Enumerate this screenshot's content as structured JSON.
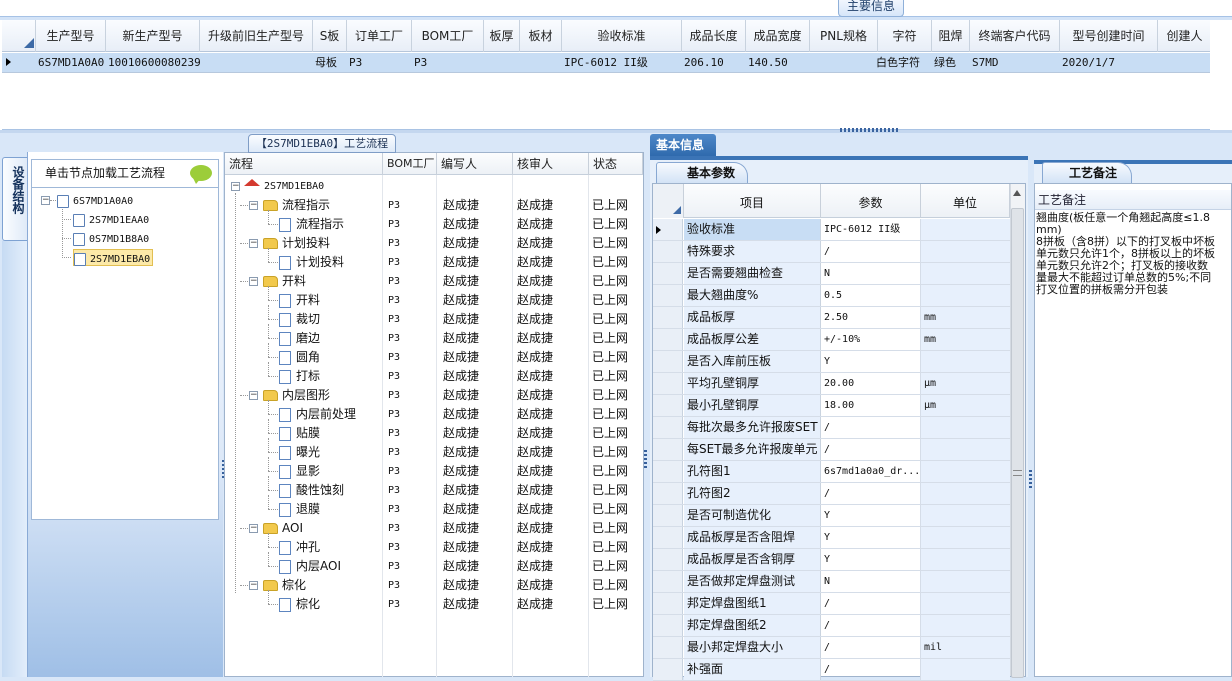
{
  "top": {
    "title": "主要信息",
    "headers": [
      "生产型号",
      "新生产型号",
      "升级前旧生产型号",
      "S板",
      "订单工厂",
      "BOM工厂",
      "板厚",
      "板材",
      "验收标准",
      "成品长度",
      "成品宽度",
      "PNL规格",
      "字符",
      "阻焊",
      "终端客户代码",
      "型号创建时间",
      "创建人"
    ],
    "row": [
      "6S7MD1A0A0",
      "10010600080239",
      "",
      "母板",
      "P3",
      "P3",
      "",
      "",
      "IPC-6012 II级",
      "206.10",
      "140.50",
      "",
      "白色字符",
      "绿色",
      "S7MD",
      "2020/1/7",
      ""
    ]
  },
  "left": {
    "vertical_tab": "设备结构",
    "hint": "单击节点加载工艺流程",
    "tree": {
      "root": "6S7MD1A0A0",
      "children": [
        "2S7MD1EAA0",
        "0S7MD1B8A0",
        "2S7MD1EBA0"
      ]
    }
  },
  "middle": {
    "title": "【2S7MD1EBA0】工艺流程",
    "headers": [
      "流程",
      "BOM工厂",
      "编写人",
      "核审人",
      "状态"
    ],
    "root": "2S7MD1EBA0",
    "rows": [
      {
        "name": "流程指示",
        "level": 1,
        "type": "folder",
        "factory": "P3",
        "writer": "赵成捷",
        "reviewer": "赵成捷",
        "status": "已上网"
      },
      {
        "name": "流程指示",
        "level": 2,
        "type": "doc",
        "factory": "P3",
        "writer": "赵成捷",
        "reviewer": "赵成捷",
        "status": "已上网"
      },
      {
        "name": "计划投料",
        "level": 1,
        "type": "folder",
        "factory": "P3",
        "writer": "赵成捷",
        "reviewer": "赵成捷",
        "status": "已上网"
      },
      {
        "name": "计划投料",
        "level": 2,
        "type": "doc",
        "factory": "P3",
        "writer": "赵成捷",
        "reviewer": "赵成捷",
        "status": "已上网"
      },
      {
        "name": "开料",
        "level": 1,
        "type": "folder",
        "factory": "P3",
        "writer": "赵成捷",
        "reviewer": "赵成捷",
        "status": "已上网"
      },
      {
        "name": "开料",
        "level": 2,
        "type": "doc",
        "factory": "P3",
        "writer": "赵成捷",
        "reviewer": "赵成捷",
        "status": "已上网"
      },
      {
        "name": "裁切",
        "level": 2,
        "type": "doc",
        "factory": "P3",
        "writer": "赵成捷",
        "reviewer": "赵成捷",
        "status": "已上网"
      },
      {
        "name": "磨边",
        "level": 2,
        "type": "doc",
        "factory": "P3",
        "writer": "赵成捷",
        "reviewer": "赵成捷",
        "status": "已上网"
      },
      {
        "name": "圆角",
        "level": 2,
        "type": "doc",
        "factory": "P3",
        "writer": "赵成捷",
        "reviewer": "赵成捷",
        "status": "已上网"
      },
      {
        "name": "打标",
        "level": 2,
        "type": "doc",
        "factory": "P3",
        "writer": "赵成捷",
        "reviewer": "赵成捷",
        "status": "已上网"
      },
      {
        "name": "内层图形",
        "level": 1,
        "type": "folder",
        "factory": "P3",
        "writer": "赵成捷",
        "reviewer": "赵成捷",
        "status": "已上网"
      },
      {
        "name": "内层前处理",
        "level": 2,
        "type": "doc",
        "factory": "P3",
        "writer": "赵成捷",
        "reviewer": "赵成捷",
        "status": "已上网"
      },
      {
        "name": "贴膜",
        "level": 2,
        "type": "doc",
        "factory": "P3",
        "writer": "赵成捷",
        "reviewer": "赵成捷",
        "status": "已上网"
      },
      {
        "name": "曝光",
        "level": 2,
        "type": "doc",
        "factory": "P3",
        "writer": "赵成捷",
        "reviewer": "赵成捷",
        "status": "已上网"
      },
      {
        "name": "显影",
        "level": 2,
        "type": "doc",
        "factory": "P3",
        "writer": "赵成捷",
        "reviewer": "赵成捷",
        "status": "已上网"
      },
      {
        "name": "酸性蚀刻",
        "level": 2,
        "type": "doc",
        "factory": "P3",
        "writer": "赵成捷",
        "reviewer": "赵成捷",
        "status": "已上网"
      },
      {
        "name": "退膜",
        "level": 2,
        "type": "doc",
        "factory": "P3",
        "writer": "赵成捷",
        "reviewer": "赵成捷",
        "status": "已上网"
      },
      {
        "name": "AOI",
        "level": 1,
        "type": "folder",
        "factory": "P3",
        "writer": "赵成捷",
        "reviewer": "赵成捷",
        "status": "已上网"
      },
      {
        "name": "冲孔",
        "level": 2,
        "type": "doc",
        "factory": "P3",
        "writer": "赵成捷",
        "reviewer": "赵成捷",
        "status": "已上网"
      },
      {
        "name": "内层AOI",
        "level": 2,
        "type": "doc",
        "factory": "P3",
        "writer": "赵成捷",
        "reviewer": "赵成捷",
        "status": "已上网"
      },
      {
        "name": "棕化",
        "level": 1,
        "type": "folder",
        "factory": "P3",
        "writer": "赵成捷",
        "reviewer": "赵成捷",
        "status": "已上网"
      },
      {
        "name": "棕化",
        "level": 2,
        "type": "doc",
        "factory": "P3",
        "writer": "赵成捷",
        "reviewer": "赵成捷",
        "status": "已上网"
      }
    ]
  },
  "info": {
    "title": "基本信息",
    "tab": "基本参数",
    "headers": [
      "项目",
      "参数",
      "单位"
    ],
    "rows": [
      {
        "name": "验收标准",
        "value": "IPC-6012 II级",
        "unit": ""
      },
      {
        "name": "特殊要求",
        "value": "/",
        "unit": ""
      },
      {
        "name": "是否需要翘曲检查",
        "value": "N",
        "unit": ""
      },
      {
        "name": "最大翘曲度%",
        "value": "0.5",
        "unit": ""
      },
      {
        "name": "成品板厚",
        "value": "2.50",
        "unit": "mm"
      },
      {
        "name": "成品板厚公差",
        "value": "+/-10%",
        "unit": "mm"
      },
      {
        "name": "是否入库前压板",
        "value": "Y",
        "unit": ""
      },
      {
        "name": "平均孔壁铜厚",
        "value": "20.00",
        "unit": "μm"
      },
      {
        "name": "最小孔壁铜厚",
        "value": "18.00",
        "unit": "μm"
      },
      {
        "name": "每批次最多允许报废SET",
        "value": "/",
        "unit": ""
      },
      {
        "name": "每SET最多允许报废单元",
        "value": "/",
        "unit": ""
      },
      {
        "name": "孔符图1",
        "value": "6s7md1a0a0_dr...",
        "unit": ""
      },
      {
        "name": "孔符图2",
        "value": "/",
        "unit": ""
      },
      {
        "name": "是否可制造优化",
        "value": "Y",
        "unit": ""
      },
      {
        "name": "成品板厚是否含阻焊",
        "value": "Y",
        "unit": ""
      },
      {
        "name": "成品板厚是否含铜厚",
        "value": "Y",
        "unit": ""
      },
      {
        "name": "是否做邦定焊盘测试",
        "value": "N",
        "unit": ""
      },
      {
        "name": "邦定焊盘图纸1",
        "value": "/",
        "unit": ""
      },
      {
        "name": "邦定焊盘图纸2",
        "value": "/",
        "unit": ""
      },
      {
        "name": "最小邦定焊盘大小",
        "value": "/",
        "unit": "mil"
      },
      {
        "name": "补强面",
        "value": "/",
        "unit": ""
      }
    ]
  },
  "notes": {
    "tab": "工艺备注",
    "header": "工艺备注",
    "text": "翘曲度(板任意一个角翘起高度≤1.8mm)\n8拼板（含8拼）以下的打叉板中坏板单元数只允许1个，8拼板以上的坏板单元数只允许2个；打叉板的接收数量最大不能超过订单总数的5%;不同打叉位置的拼板需分开包装"
  },
  "colors": {
    "accent": "#2f6aad",
    "selected_row": "#c8ddf4",
    "folder": "#f2c94c"
  }
}
